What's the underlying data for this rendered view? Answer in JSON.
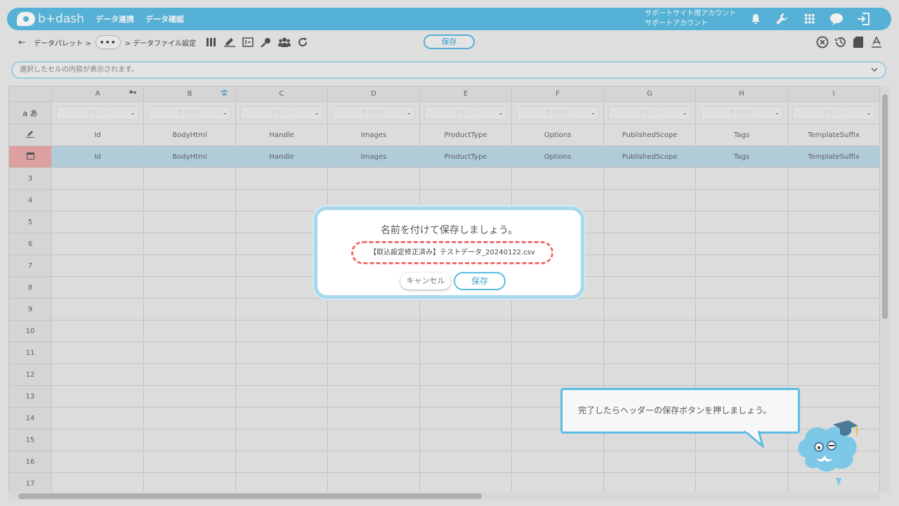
{
  "header": {
    "logo": "b+dash",
    "nav": [
      "データ連携",
      "データ確認"
    ],
    "account_line1": "サポートサイト用アカウント",
    "account_line2": "サポートアカウント",
    "icons": [
      "bell-icon",
      "wrench-icon",
      "grid-icon",
      "chat-icon",
      "logout-icon"
    ]
  },
  "toolbar": {
    "back_arrow": "←",
    "crumb1": "データパレット >",
    "more": "•••",
    "crumb2": "> データファイル設定",
    "save_label": "保存"
  },
  "cellbar": {
    "placeholder": "選択したセルの内容が表示されます。"
  },
  "sheet": {
    "columns": [
      "A",
      "B",
      "C",
      "D",
      "E",
      "F",
      "G",
      "H",
      "I"
    ],
    "type_row_label": "a あ",
    "type_placeholder": "テキスト",
    "field_names": [
      "Id",
      "BodyHtml",
      "Handle",
      "Images",
      "ProductType",
      "Options",
      "PublishedScope",
      "Tags",
      "TemplateSuffix"
    ],
    "row_numbers": [
      "3",
      "4",
      "5",
      "6",
      "7",
      "8",
      "9",
      "10",
      "11",
      "12",
      "13",
      "14",
      "15",
      "16",
      "17"
    ]
  },
  "dialog": {
    "title": "名前を付けて保存しましょう。",
    "filename": "【取込設定修正済み】テストデータ_20240122.csv",
    "cancel_label": "キャンセル",
    "save_label": "保存"
  },
  "guide": {
    "message": "完了したらヘッダーの保存ボタンを押しましょう。"
  },
  "colors": {
    "accent": "#5bbde4",
    "selected_row": "#bcd9e6",
    "selected_header": "#eaaaaa",
    "dashed": "#f07070"
  }
}
